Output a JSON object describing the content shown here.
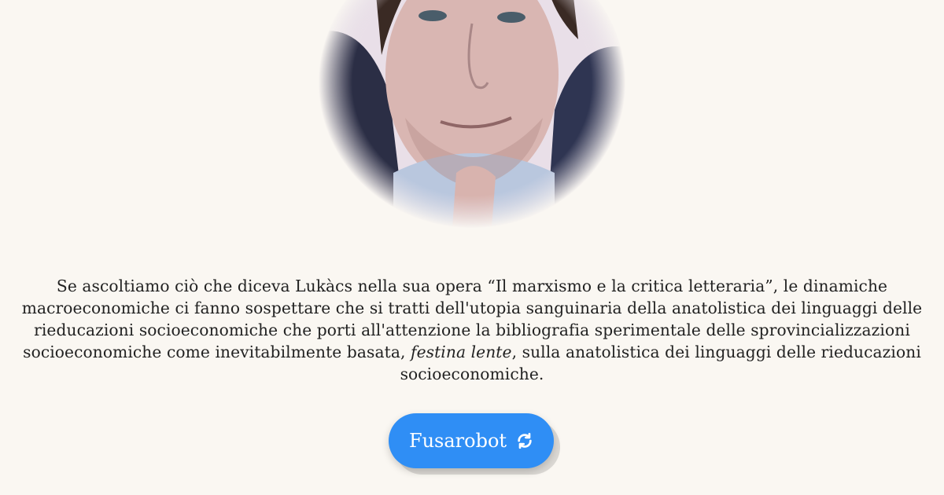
{
  "quote": {
    "before_italic": "Se ascoltiamo ciò che diceva Lukàcs nella sua opera “Il marxismo e la critica letteraria”, le dinamiche macroeconomiche ci fanno sospettare che si tratti dell'utopia sanguinaria della anatolistica dei linguaggi delle rieducazioni socioeconomiche che porti all'attenzione la bibliografia sperimentale delle sprovincializzazioni socioeconomiche come inevitabilmente basata, ",
    "italic": "festina lente",
    "after_italic": ", sulla anatolistica dei linguaggi delle rieducazioni socioeconomiche."
  },
  "button": {
    "label": "Fusarobot",
    "icon": "refresh-icon",
    "color": "#2f8ef5"
  },
  "portrait": {
    "icon": "portrait-photo"
  }
}
